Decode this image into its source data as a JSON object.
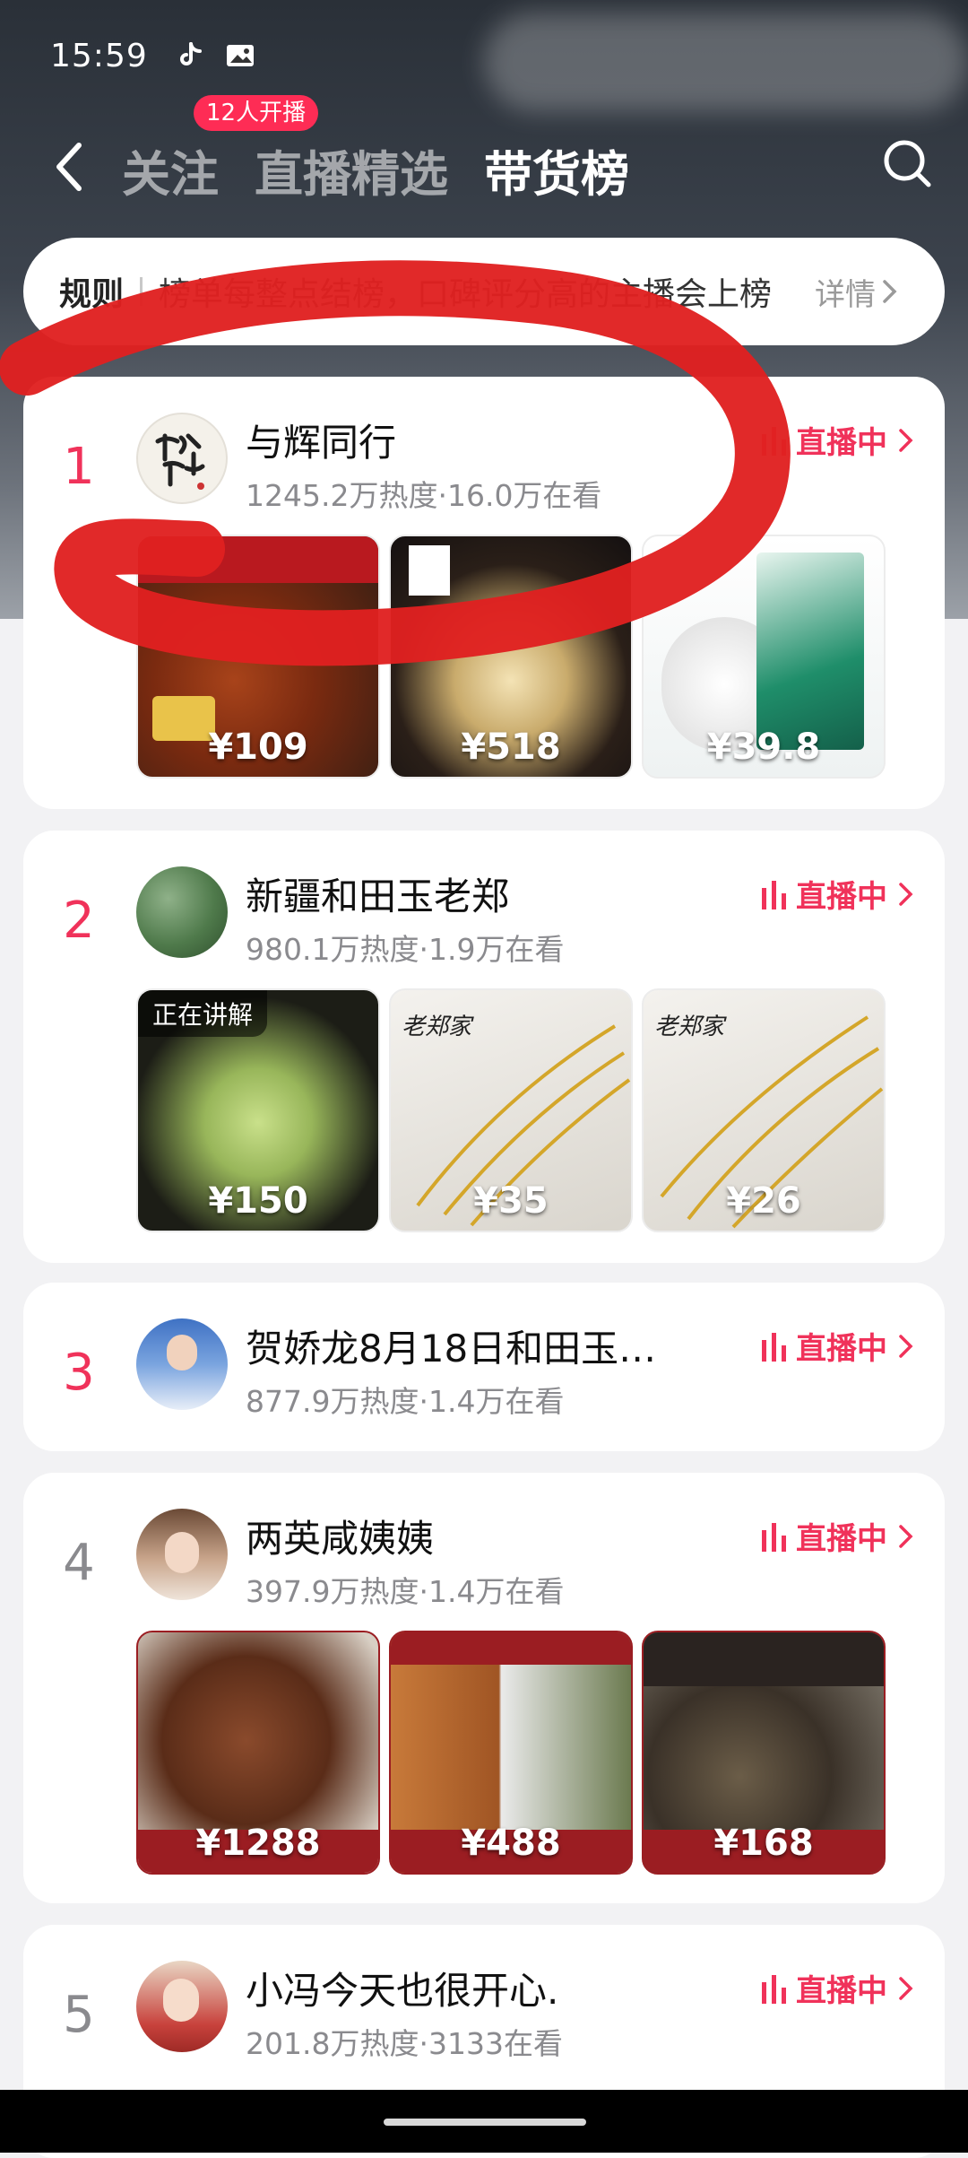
{
  "status_bar": {
    "time": "15:59",
    "icons": [
      "tiktok-icon",
      "image-icon"
    ]
  },
  "nav": {
    "back_icon": "chevron-left-icon",
    "tabs": [
      {
        "label": "关注",
        "active": false
      },
      {
        "label": "直播精选",
        "active": false
      },
      {
        "label": "带货榜",
        "active": true
      }
    ],
    "live_badge": "12人开播",
    "search_icon": "search-icon"
  },
  "rules": {
    "title": "规则",
    "text": "榜单每整点结榜，口碑评分高的主播会上榜",
    "detail": "详情"
  },
  "live_label": "直播中",
  "colors": {
    "accent": "#f0325a",
    "badge": "#fe2c55",
    "annotation_stroke": "#e02020"
  },
  "streamers": [
    {
      "rank": "1",
      "name": "与辉同行",
      "stats": "1245.2万热度·16.0万在看",
      "products": [
        {
          "price": "¥109",
          "tag": "",
          "explaining": ""
        },
        {
          "price": "¥518",
          "tag": "",
          "explaining": ""
        },
        {
          "price": "¥39.8",
          "tag": "",
          "explaining": ""
        }
      ]
    },
    {
      "rank": "2",
      "name": "新疆和田玉老郑",
      "stats": "980.1万热度·1.9万在看",
      "products": [
        {
          "price": "¥150",
          "tag": "",
          "explaining": "正在讲解"
        },
        {
          "price": "¥35",
          "tag": "老郑家",
          "explaining": ""
        },
        {
          "price": "¥26",
          "tag": "老郑家",
          "explaining": ""
        }
      ]
    },
    {
      "rank": "3",
      "name": "贺娇龙8月18日和田玉…",
      "stats": "877.9万热度·1.4万在看",
      "products": []
    },
    {
      "rank": "4",
      "name": "两英咸姨姨",
      "stats": "397.9万热度·1.4万在看",
      "products": [
        {
          "price": "¥1288",
          "tag": "",
          "explaining": ""
        },
        {
          "price": "¥488",
          "tag": "",
          "explaining": ""
        },
        {
          "price": "¥168",
          "tag": "",
          "explaining": ""
        }
      ]
    },
    {
      "rank": "5",
      "name": "小冯今天也很开心.",
      "stats": "201.8万热度·3133在看",
      "products": []
    }
  ]
}
